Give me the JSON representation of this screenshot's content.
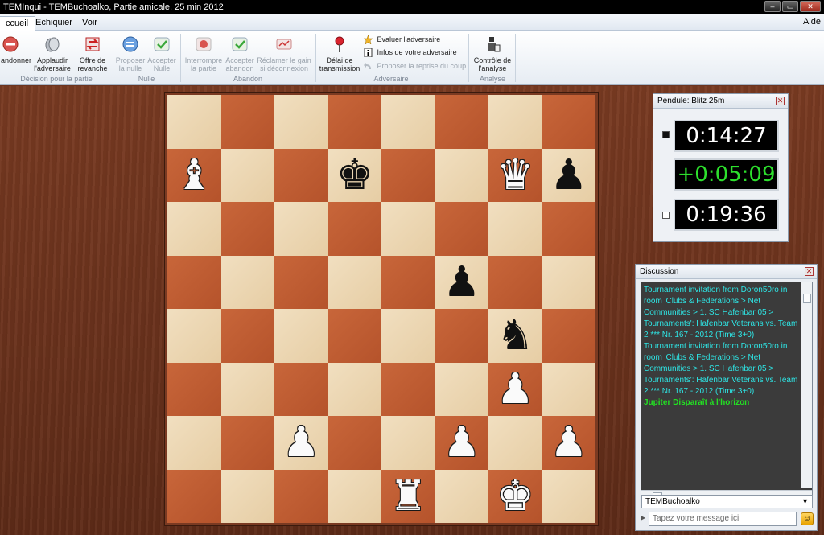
{
  "window": {
    "title": "TEMInqui - TEMBuchoalko, Partie amicale, 25 min 2012",
    "controls": {
      "minimize": "–",
      "maximize": "▭",
      "close": "✕"
    }
  },
  "menu": {
    "tabs": [
      "ccueil",
      "Echiquier",
      "Voir"
    ],
    "help": "Aide"
  },
  "ribbon": {
    "groups": {
      "decision": "Décision pour la partie",
      "nulle": "Nulle",
      "abandon": "Abandon",
      "adversaire": "Adversaire",
      "analyse": "Analyse"
    },
    "buttons": {
      "abandonner": "andonner",
      "applaudir": "Applaudir l'adversaire",
      "revanche": "Offre de revanche",
      "proposer_nulle": "Proposer la nulle",
      "accepter_nulle": "Accepter Nulle",
      "interrompre": "Interrompre la partie",
      "accepter_abandon": "Accepter abandon",
      "reclamer_gain": "Réclamer le gain si déconnexion",
      "delai": "Délai de transmission",
      "controle": "Contrôle de l'analyse"
    },
    "small_items": {
      "evaluer": "Evaluer l'adversaire",
      "infos": "Infos de votre adversaire",
      "reprise": "Proposer la reprise du coup"
    }
  },
  "board": {
    "rows": [
      [
        "",
        "",
        "",
        "",
        "",
        "",
        "",
        ""
      ],
      [
        "wB",
        "",
        "",
        "bK",
        "",
        "",
        "wQ",
        "bP"
      ],
      [
        "",
        "",
        "",
        "",
        "",
        "",
        "",
        ""
      ],
      [
        "",
        "",
        "",
        "",
        "",
        "bP",
        "",
        ""
      ],
      [
        "",
        "",
        "",
        "",
        "",
        "",
        "bN",
        ""
      ],
      [
        "",
        "",
        "",
        "",
        "",
        "",
        "wP",
        ""
      ],
      [
        "",
        "",
        "wP",
        "",
        "",
        "wP",
        "",
        "wP"
      ],
      [
        "",
        "",
        "",
        "",
        "wR",
        "",
        "wK",
        ""
      ]
    ]
  },
  "clock": {
    "title": "Pendule: Blitz 25m",
    "top": "0:14:27",
    "delta": "+0:05:09",
    "bottom": "0:19:36",
    "active_player": "top"
  },
  "chat": {
    "title": "Discussion",
    "messages": [
      {
        "type": "info",
        "text": "Tournament invitation from Doron50ro in room 'Clubs & Federations > Net Communities > 1. SC Hafenbar 05 > Tournaments': Hafenbar Veterans vs. Team 2 *** Nr. 167 - 2012 (Time 3+0)"
      },
      {
        "type": "info",
        "text": "Tournament invitation from Doron50ro in room 'Clubs & Federations > Net Communities > 1. SC Hafenbar 05 > Tournaments': Hafenbar Veterans vs. Team 2 *** Nr. 167 - 2012 (Time 3+0)"
      },
      {
        "type": "event",
        "text": "Jupiter Disparaît à l'horizon"
      }
    ],
    "recipient": "TEMBuchoalko",
    "input_placeholder": "Tapez votre message ici"
  },
  "colors": {
    "light_square": "#eed9b6",
    "dark_square": "#c05e33",
    "clock_delta": "#2de02d",
    "chat_info": "#2ee6e6",
    "chat_event": "#23e023"
  }
}
